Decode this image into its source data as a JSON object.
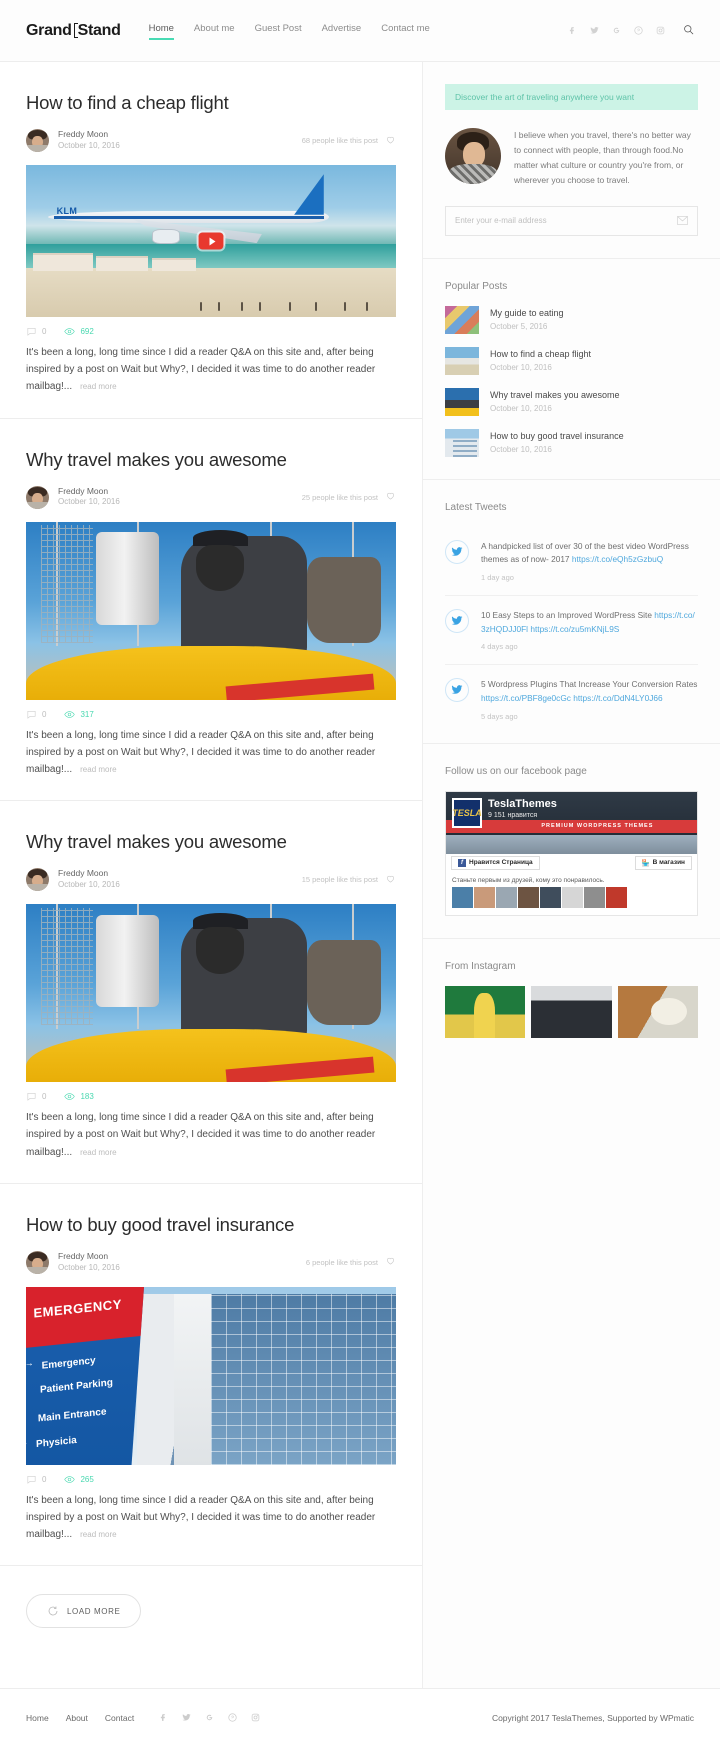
{
  "header": {
    "logo_left": "Grand",
    "logo_right": "Stand",
    "nav": [
      {
        "label": "Home",
        "active": true
      },
      {
        "label": "About me",
        "active": false
      },
      {
        "label": "Guest Post",
        "active": false
      },
      {
        "label": "Advertise",
        "active": false
      },
      {
        "label": "Contact me",
        "active": false
      }
    ],
    "social": [
      "facebook-icon",
      "twitter-icon",
      "google-plus-icon",
      "pinterest-icon",
      "instagram-icon"
    ],
    "search": "search-icon",
    "accent_color": "#48dbb4"
  },
  "posts": [
    {
      "title": "How to find a cheap flight",
      "author": "Freddy Moon",
      "date": "October 10, 2016",
      "likes": "68 people like this post",
      "comments": "0",
      "views": "692",
      "excerpt": "It's been a long, long time since I did a reader Q&A on this site and, after being inspired by a post on Wait but Why?, I decided it was time to do another reader mailbag!...",
      "readmore": "read more",
      "media": "airplane-beach-video",
      "has_video": true
    },
    {
      "title": "Why travel makes you awesome",
      "author": "Freddy Moon",
      "date": "October 10, 2016",
      "likes": "25 people like this post",
      "comments": "0",
      "views": "317",
      "excerpt": "It's been a long, long time since I did a reader Q&A on this site and, after being inspired by a post on Wait but Why?, I decided it was time to do another reader mailbag!...",
      "readmore": "read more",
      "media": "balloon-pilot",
      "has_video": false
    },
    {
      "title": "Why travel makes you awesome",
      "author": "Freddy Moon",
      "date": "October 10, 2016",
      "likes": "15 people like this post",
      "comments": "0",
      "views": "183",
      "excerpt": "It's been a long, long time since I did a reader Q&A on this site and, after being inspired by a post on Wait but Why?, I decided it was time to do another reader mailbag!...",
      "readmore": "read more",
      "media": "balloon-pilot",
      "has_video": false
    },
    {
      "title": "How to buy good travel insurance",
      "author": "Freddy Moon",
      "date": "October 10, 2016",
      "likes": "6 people like this post",
      "comments": "0",
      "views": "265",
      "excerpt": "It's been a long, long time since I did a reader Q&A on this site and, after being inspired by a post on Wait but Why?, I decided it was time to do another reader mailbag!...",
      "readmore": "read more",
      "media": "hospital-emergency-sign",
      "has_video": false
    }
  ],
  "load_more": "LOAD MORE",
  "sidebar": {
    "promo": "Discover the art of traveling anywhere you want",
    "about_text": "I believe when you travel, there's no better way to connect with people, than through food.No matter what culture or country you're from, or wherever you choose to travel.",
    "subscribe_placeholder": "Enter your e-mail address",
    "popular_title": "Popular Posts",
    "popular_posts": [
      {
        "title": "My guide to eating",
        "date": "October 5, 2016"
      },
      {
        "title": "How to find a cheap flight",
        "date": "October 10, 2016"
      },
      {
        "title": "Why travel makes you awesome",
        "date": "October 10, 2016"
      },
      {
        "title": "How to buy good travel insurance",
        "date": "October 10, 2016"
      }
    ],
    "tweets_title": "Latest Tweets",
    "tweets": [
      {
        "text": "A handpicked list of over 30 of the best video WordPress themes as of now- 2017 ",
        "link1": "https://t.co/eQh5zGzbuQ",
        "link2": "",
        "time": "1 day ago"
      },
      {
        "text": "10 Easy Steps to an Improved WordPress Site ",
        "link1": "https://t.co/3zHQDJJ0Fl",
        "link2": "https://t.co/zu5mKNjL9S",
        "time": "4 days ago"
      },
      {
        "text": "5 Wordpress Plugins That Increase Your Conversion Rates ",
        "link1": "https://t.co/PBF8ge0cGc",
        "link2": "https://t.co/DdN4LY0J66",
        "time": "5 days ago"
      }
    ],
    "facebook_title": "Follow us on our facebook page",
    "facebook": {
      "page_name": "TeslaThemes",
      "likes": "9 151 нравится",
      "banner": "PREMIUM WORDPRESS THEMES",
      "like_button": "Нравится Страница",
      "shop_button": "В магазин",
      "sub_text": "Станьте первым из друзей, кому это понравилось."
    },
    "instagram_title": "From Instagram"
  },
  "footer": {
    "links": [
      "Home",
      "About",
      "Contact"
    ],
    "social": [
      "facebook-icon",
      "twitter-icon",
      "google-plus-icon",
      "pinterest-icon",
      "instagram-icon"
    ],
    "copyright": "Copyright 2017 TeslaThemes, Supported by WPmatic"
  }
}
